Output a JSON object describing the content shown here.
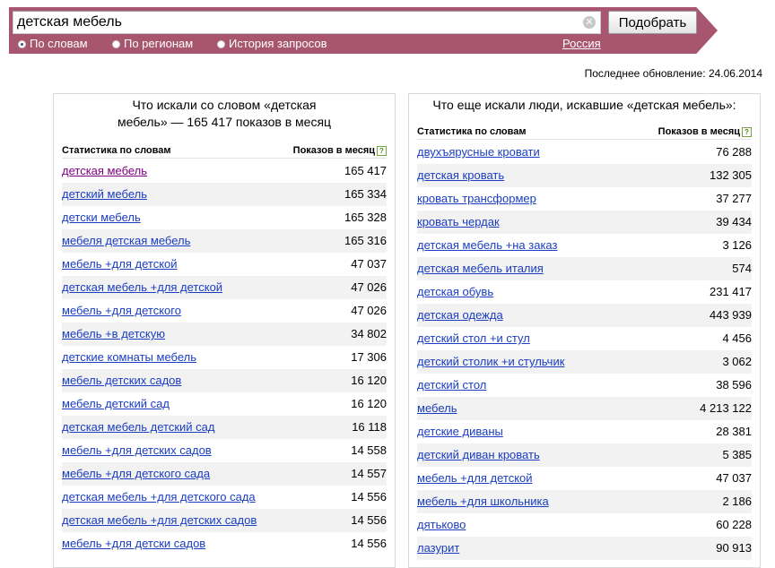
{
  "search": {
    "query": "детская мебель",
    "button_label": "Подобрать"
  },
  "modes": [
    {
      "label": "По словам",
      "selected": true
    },
    {
      "label": "По регионам",
      "selected": false
    },
    {
      "label": "История запросов",
      "selected": false
    }
  ],
  "region": "Россия",
  "last_update": "Последнее обновление: 24.06.2014",
  "left_panel": {
    "title_line1": "Что искали со словом «детская",
    "title_line2": "мебель» — 165 417 показов в месяц",
    "col_phrase": "Статистика по словам",
    "col_count": "Показов в месяц",
    "rows": [
      {
        "phrase": "детская мебель",
        "count": "165 417",
        "visited": true
      },
      {
        "phrase": "детский мебель",
        "count": "165 334"
      },
      {
        "phrase": "детски мебель",
        "count": "165 328"
      },
      {
        "phrase": "мебеля детская мебель",
        "count": "165 316"
      },
      {
        "phrase": "мебель +для детской",
        "count": "47 037"
      },
      {
        "phrase": "детская мебель +для детской",
        "count": "47 026"
      },
      {
        "phrase": "мебель +для детского",
        "count": "47 026"
      },
      {
        "phrase": "мебель +в детскую",
        "count": "34 802"
      },
      {
        "phrase": "детские комнаты мебель",
        "count": "17 306"
      },
      {
        "phrase": "мебель детских садов",
        "count": "16 120"
      },
      {
        "phrase": "мебель детский сад",
        "count": "16 120"
      },
      {
        "phrase": "детская мебель детский сад",
        "count": "16 118"
      },
      {
        "phrase": "мебель +для детских садов",
        "count": "14 558"
      },
      {
        "phrase": "мебель +для детского сада",
        "count": "14 557"
      },
      {
        "phrase": "детская мебель +для детского сада",
        "count": "14 556"
      },
      {
        "phrase": "детская мебель +для детских садов",
        "count": "14 556"
      },
      {
        "phrase": "мебель +для детски садов",
        "count": "14 556"
      }
    ]
  },
  "right_panel": {
    "title": "Что еще искали люди, искавшие «детская мебель»:",
    "col_phrase": "Статистика по словам",
    "col_count": "Показов в месяц",
    "rows": [
      {
        "phrase": "двухъярусные кровати",
        "count": "76 288"
      },
      {
        "phrase": "детская кровать",
        "count": "132 305"
      },
      {
        "phrase": "кровать трансформер",
        "count": "37 277"
      },
      {
        "phrase": "кровать чердак",
        "count": "39 434"
      },
      {
        "phrase": "детская мебель +на заказ",
        "count": "3 126"
      },
      {
        "phrase": "детская мебель италия",
        "count": "574"
      },
      {
        "phrase": "детская обувь",
        "count": "231 417"
      },
      {
        "phrase": "детская одежда",
        "count": "443 939"
      },
      {
        "phrase": "детский стол +и стул",
        "count": "4 456"
      },
      {
        "phrase": "детский столик +и стульчик",
        "count": "3 062"
      },
      {
        "phrase": "детский стол",
        "count": "38 596"
      },
      {
        "phrase": "мебель",
        "count": "4 213 122"
      },
      {
        "phrase": "детские диваны",
        "count": "28 381"
      },
      {
        "phrase": "детский диван кровать",
        "count": "5 385"
      },
      {
        "phrase": "мебель +для детской",
        "count": "47 037"
      },
      {
        "phrase": "мебель +для школьника",
        "count": "2 186"
      },
      {
        "phrase": "дятьково",
        "count": "60 228"
      },
      {
        "phrase": "лазурит",
        "count": "90 913"
      }
    ]
  },
  "help_icon": "?"
}
